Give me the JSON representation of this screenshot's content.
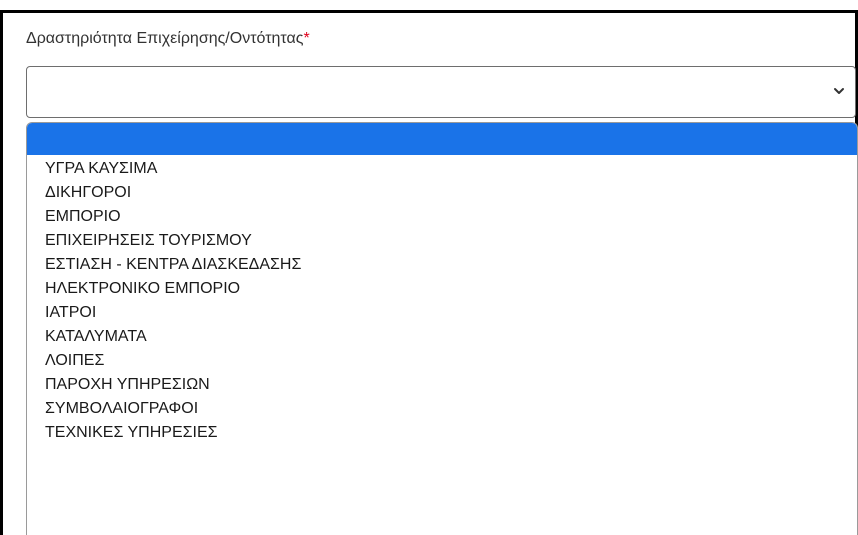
{
  "form": {
    "label": "Δραστηριότητα Επιχείρησης/Οντότητας",
    "required_marker": "*",
    "select_value": "",
    "required_color": "#e0001b"
  },
  "dropdown": {
    "highlight_color": "#1a73e8",
    "options": [
      "",
      "ΥΓΡΑ ΚΑΥΣΙΜΑ",
      "ΔΙΚΗΓΟΡΟΙ",
      "ΕΜΠΟΡΙΟ",
      "ΕΠΙΧΕΙΡΗΣΕΙΣ ΤΟΥΡΙΣΜΟΥ",
      "ΕΣΤΙΑΣΗ - ΚΕΝΤΡΑ ΔΙΑΣΚΕΔΑΣΗΣ",
      "ΗΛΕΚΤΡΟΝΙΚΟ ΕΜΠΟΡΙΟ",
      "ΙΑΤΡΟΙ",
      "ΚΑΤΑΛΥΜΑΤΑ",
      "ΛΟΙΠΕΣ",
      "ΠΑΡΟΧΗ ΥΠΗΡΕΣΙΩΝ",
      "ΣΥΜΒΟΛΑΙΟΓΡΑΦΟΙ",
      "ΤΕΧΝΙΚΕΣ ΥΠΗΡΕΣΙΕΣ"
    ]
  }
}
